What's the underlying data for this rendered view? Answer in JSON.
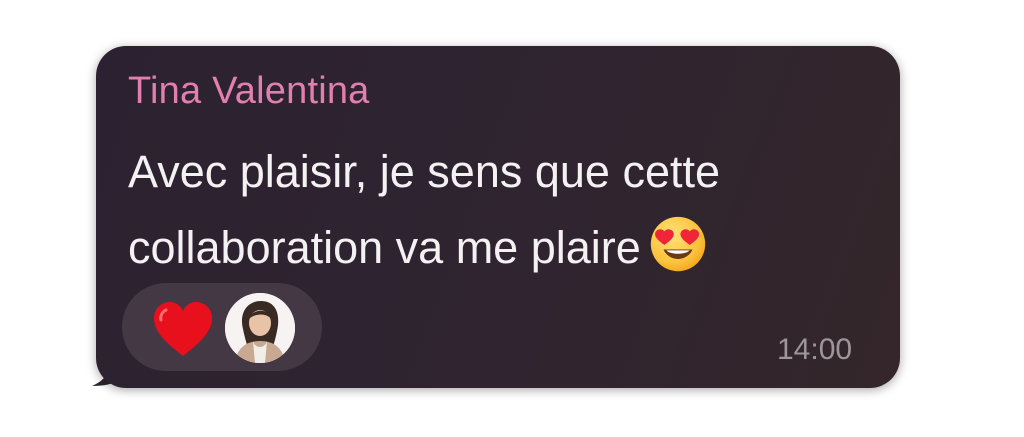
{
  "message": {
    "sender_name": "Tina Valentina",
    "text_line_1": "Avec plaisir, je sens que cette",
    "text_line_2": "collaboration va me plaire",
    "emoji_icon": "heart-eyes-emoji",
    "timestamp": "14:00"
  },
  "reactions": {
    "reaction_icon": "red-heart-icon",
    "reactor_avatar": "avatar"
  },
  "colors": {
    "bubble_background": "#2f2430",
    "sender_name": "#e07fb0",
    "message_text": "#f4f1f3",
    "timestamp": "#9d969c",
    "reaction_pill": "#443845",
    "heart": "#e8101c"
  }
}
